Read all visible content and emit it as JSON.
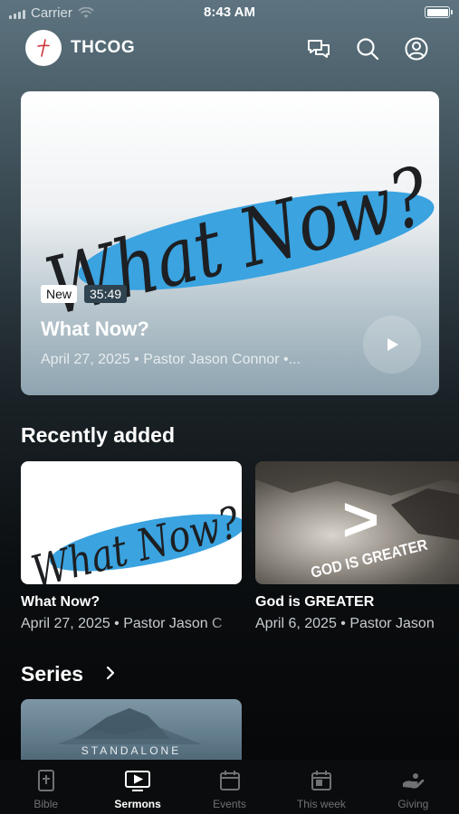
{
  "status_bar": {
    "carrier": "Carrier",
    "time": "8:43 AM"
  },
  "header": {
    "title": "THCOG",
    "icons": [
      "chat-icon",
      "search-icon",
      "account-icon"
    ]
  },
  "hero": {
    "artwork_text": "What Now?",
    "badge_new": "New",
    "duration": "35:49",
    "title": "What Now?",
    "meta": "April 27, 2025 • Pastor Jason Connor  •..."
  },
  "recently_added": {
    "title": "Recently added",
    "items": [
      {
        "title": "What Now?",
        "meta": "April 27, 2025 • Pastor Jason C",
        "artwork_text": "What Now?"
      },
      {
        "title": "God is GREATER",
        "meta": "April 6, 2025 • Pastor Jason",
        "artwork_text": "GOD IS GREATER",
        "artwork_symbol": ">"
      }
    ]
  },
  "series": {
    "title": "Series",
    "first_label": "STANDALONE"
  },
  "tabs": [
    {
      "label": "Bible",
      "icon": "bible-icon"
    },
    {
      "label": "Sermons",
      "icon": "tv-icon",
      "active": true
    },
    {
      "label": "Events",
      "icon": "calendar-icon"
    },
    {
      "label": "This week",
      "icon": "calendar-week-icon"
    },
    {
      "label": "Giving",
      "icon": "giving-hand-icon"
    }
  ],
  "colors": {
    "accent_blue": "#3aa3e0",
    "logo_red": "#d0343a",
    "tab_inactive": "#6f7275"
  }
}
